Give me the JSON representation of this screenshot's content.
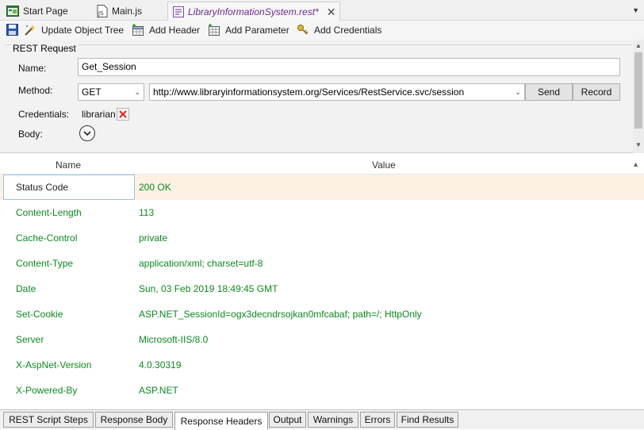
{
  "tabs": [
    {
      "label": "Start Page",
      "icon": "start-page-icon"
    },
    {
      "label": "Main.js",
      "icon": "js-file-icon"
    },
    {
      "label": "LibraryInformationSystem.rest*",
      "icon": "rest-file-icon",
      "active": true
    }
  ],
  "toolbar": {
    "update_object_tree": "Update Object Tree",
    "add_header": "Add Header",
    "add_parameter": "Add Parameter",
    "add_credentials": "Add Credentials"
  },
  "request": {
    "group_title": "REST Request",
    "name_label": "Name:",
    "name_value": "Get_Session",
    "method_label": "Method:",
    "method_value": "GET",
    "url_value": "http://www.libraryinformationsystem.org/Services/RestService.svc/session",
    "send_label": "Send",
    "record_label": "Record",
    "credentials_label": "Credentials:",
    "credentials_value": "librarian",
    "body_label": "Body:"
  },
  "grid": {
    "headers": {
      "name": "Name",
      "value": "Value"
    },
    "rows": [
      {
        "name": "Status Code",
        "value": "200 OK",
        "selected": true
      },
      {
        "name": "Content-Length",
        "value": "113"
      },
      {
        "name": "Cache-Control",
        "value": "private"
      },
      {
        "name": "Content-Type",
        "value": "application/xml; charset=utf-8"
      },
      {
        "name": "Date",
        "value": "Sun, 03 Feb 2019 18:49:45 GMT"
      },
      {
        "name": "Set-Cookie",
        "value": "ASP.NET_SessionId=ogx3decndrsojkan0mfcabaf; path=/; HttpOnly"
      },
      {
        "name": "Server",
        "value": "Microsoft-IIS/8.0"
      },
      {
        "name": "X-AspNet-Version",
        "value": "4.0.30319"
      },
      {
        "name": "X-Powered-By",
        "value": "ASP.NET"
      }
    ]
  },
  "bottom_tabs": [
    {
      "label": "REST Script Steps"
    },
    {
      "label": "Response Body"
    },
    {
      "label": "Response Headers",
      "active": true
    },
    {
      "label": "Output"
    },
    {
      "label": "Warnings"
    },
    {
      "label": "Errors"
    },
    {
      "label": "Find Results"
    }
  ],
  "colors": {
    "active_tab_text": "#6a2a8e",
    "header_text_green": "#0c8a1f",
    "selected_row_bg": "#fdf1e4"
  }
}
